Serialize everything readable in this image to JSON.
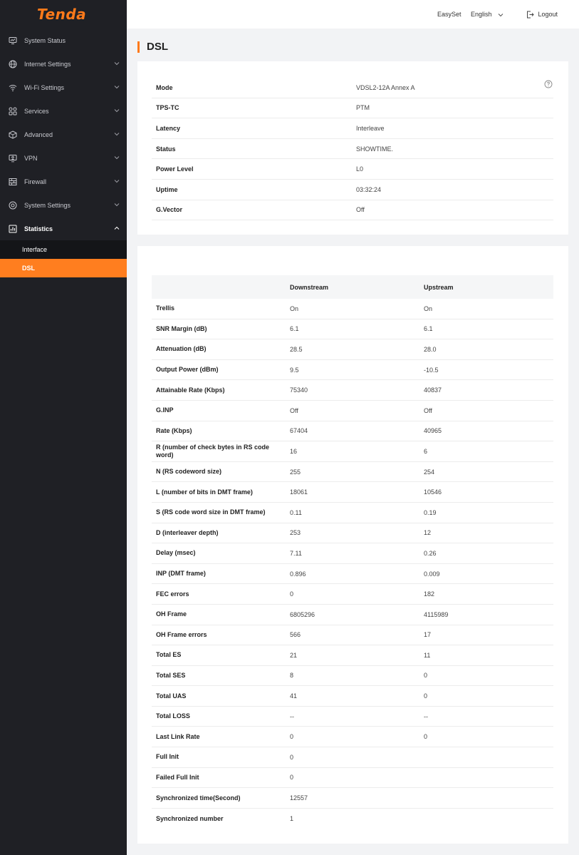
{
  "brand": {
    "logo_text": "Tenda",
    "accent": "#ff7a1a"
  },
  "header": {
    "easyset": "EasySet",
    "language": "English",
    "logout": "Logout"
  },
  "sidebar": {
    "items": [
      {
        "label": "System Status",
        "icon": "monitor-icon"
      },
      {
        "label": "Internet Settings",
        "icon": "globe-icon"
      },
      {
        "label": "Wi-Fi Settings",
        "icon": "wifi-icon"
      },
      {
        "label": "Services",
        "icon": "grid-icon"
      },
      {
        "label": "Advanced",
        "icon": "cube-icon"
      },
      {
        "label": "VPN",
        "icon": "vpn-icon"
      },
      {
        "label": "Firewall",
        "icon": "firewall-icon"
      },
      {
        "label": "System Settings",
        "icon": "settings-icon"
      },
      {
        "label": "Statistics",
        "icon": "chart-icon"
      }
    ],
    "sub_items": [
      {
        "label": "Interface"
      },
      {
        "label": "DSL"
      }
    ]
  },
  "page": {
    "title": "DSL"
  },
  "info": [
    {
      "label": "Mode",
      "value": "VDSL2-12A Annex A"
    },
    {
      "label": "TPS-TC",
      "value": "PTM"
    },
    {
      "label": "Latency",
      "value": "Interleave"
    },
    {
      "label": "Status",
      "value": "SHOWTIME."
    },
    {
      "label": "Power Level",
      "value": "L0"
    },
    {
      "label": "Uptime",
      "value": "03:32:24"
    },
    {
      "label": "G.Vector",
      "value": "Off"
    }
  ],
  "stats": {
    "headers": {
      "down": "Downstream",
      "up": "Upstream"
    },
    "rows": [
      {
        "label": "Trellis",
        "down": "On",
        "up": "On"
      },
      {
        "label": "SNR Margin (dB)",
        "down": "6.1",
        "up": "6.1"
      },
      {
        "label": "Attenuation (dB)",
        "down": "28.5",
        "up": "28.0"
      },
      {
        "label": "Output Power (dBm)",
        "down": "9.5",
        "up": "-10.5"
      },
      {
        "label": "Attainable Rate (Kbps)",
        "down": "75340",
        "up": "40837"
      },
      {
        "label": "G.INP",
        "down": "Off",
        "up": "Off"
      },
      {
        "label": "Rate (Kbps)",
        "down": "67404",
        "up": "40965"
      },
      {
        "label": "R (number of check bytes in RS code word)",
        "down": "16",
        "up": "6"
      },
      {
        "label": "N (RS codeword size)",
        "down": "255",
        "up": "254"
      },
      {
        "label": "L (number of bits in DMT frame)",
        "down": "18061",
        "up": "10546"
      },
      {
        "label": "S (RS code word size in DMT frame)",
        "down": "0.11",
        "up": "0.19"
      },
      {
        "label": "D (interleaver depth)",
        "down": "253",
        "up": "12"
      },
      {
        "label": "Delay (msec)",
        "down": "7.11",
        "up": "0.26"
      },
      {
        "label": "INP (DMT frame)",
        "down": "0.896",
        "up": "0.009"
      },
      {
        "label": "FEC errors",
        "down": "0",
        "up": "182"
      },
      {
        "label": "OH Frame",
        "down": "6805296",
        "up": "4115989"
      },
      {
        "label": "OH Frame errors",
        "down": "566",
        "up": "17"
      },
      {
        "label": "Total ES",
        "down": "21",
        "up": "11"
      },
      {
        "label": "Total SES",
        "down": "8",
        "up": "0"
      },
      {
        "label": "Total UAS",
        "down": "41",
        "up": "0"
      },
      {
        "label": "Total LOSS",
        "down": "--",
        "up": "--"
      },
      {
        "label": "Last Link Rate",
        "down": "0",
        "up": "0"
      },
      {
        "label": "Full Init",
        "down": "0",
        "up": ""
      },
      {
        "label": "Failed Full Init",
        "down": "0",
        "up": ""
      },
      {
        "label": "Synchronized time(Second)",
        "down": "12557",
        "up": ""
      },
      {
        "label": "Synchronized number",
        "down": "1",
        "up": ""
      }
    ]
  }
}
